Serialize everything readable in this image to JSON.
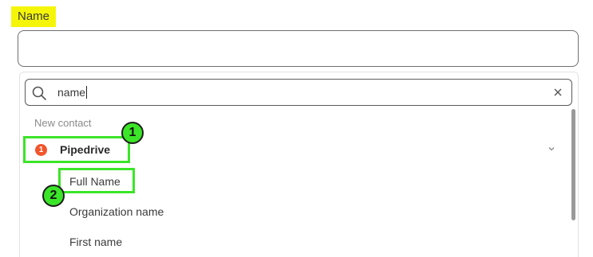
{
  "field": {
    "label": "Name",
    "value": ""
  },
  "search": {
    "value": "name",
    "icon": "search-icon",
    "clear_icon": "close-icon"
  },
  "dropdown": {
    "section_header": "New contact",
    "app": {
      "badge": "1",
      "name": "Pipedrive",
      "icon": "chevron-down-icon"
    },
    "options": [
      "Full Name",
      "Organization name",
      "First name"
    ]
  },
  "annotations": {
    "marker_1": "1",
    "marker_2": "2",
    "highlight_color": "#3be528",
    "label_highlight_color": "#f5f50a"
  },
  "colors": {
    "app_badge": "#f2552c"
  }
}
